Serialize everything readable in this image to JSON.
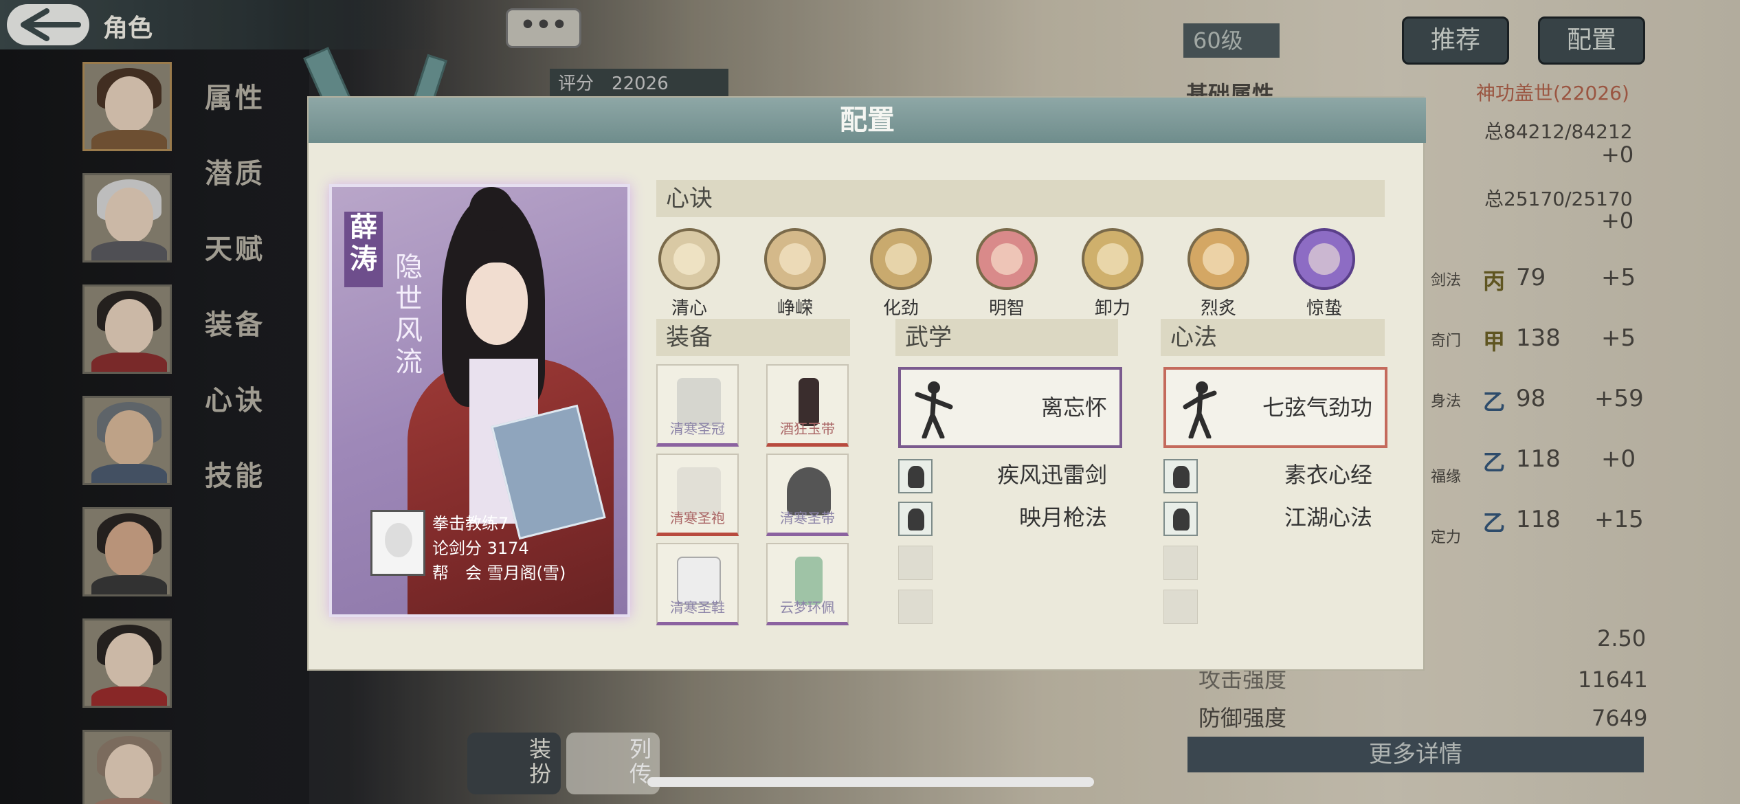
{
  "window": {
    "title": "角色"
  },
  "sidebar": {
    "tabs": [
      "属性",
      "潜质",
      "天赋",
      "装备",
      "心诀",
      "技能"
    ]
  },
  "background": {
    "level": "60级",
    "score_label": "评分",
    "score_value": "22026",
    "buttons": {
      "recommend": "推荐",
      "config": "配置"
    },
    "section_title": "基础属性",
    "power_title": "神功盖世(22026)",
    "hp_total": "总84212/84212",
    "hp_bonus": "+0",
    "mp_total": "总25170/25170",
    "mp_bonus": "+0",
    "stats": [
      {
        "name": "剑法",
        "rank": "丙",
        "value": "79",
        "bonus": "+5"
      },
      {
        "name": "奇门",
        "rank": "甲",
        "value": "138",
        "bonus": "+5"
      },
      {
        "name": "身法",
        "rank": "乙",
        "value": "98",
        "bonus": "+59"
      },
      {
        "name": "福缘",
        "rank": "乙",
        "value": "118",
        "bonus": "+0"
      },
      {
        "name": "定力",
        "rank": "乙",
        "value": "118",
        "bonus": "+15"
      }
    ],
    "extra_value": "2.50",
    "attack_label": "攻击强度",
    "attack_value": "11641",
    "defense_label": "防御强度",
    "defense_value": "7649",
    "more_details": "更多详情",
    "bottom_tabs": {
      "dress": "装扮",
      "bio": "列传"
    },
    "chat": "•••"
  },
  "dialog": {
    "title": "配置",
    "character": {
      "name": "薛涛",
      "epithet": "隐世风流",
      "club_lines": [
        {
          "label": "拳击教练7",
          "value": ""
        },
        {
          "label": "论剑分",
          "value": "3174"
        },
        {
          "label": "帮　会",
          "value": "雪月阁(雪)"
        }
      ]
    },
    "xinjue": {
      "header": "心诀",
      "items": [
        {
          "name": "清心",
          "color": "#d9c9a4"
        },
        {
          "name": "峥嵘",
          "color": "#d4b98a"
        },
        {
          "name": "化劲",
          "color": "#c9aa6e"
        },
        {
          "name": "明智",
          "color": "#d98a8a"
        },
        {
          "name": "卸力",
          "color": "#cfb06c"
        },
        {
          "name": "烈炙",
          "color": "#d4a764"
        },
        {
          "name": "惊蛰",
          "color": "#8d6cc4"
        }
      ]
    },
    "equipment": {
      "header": "装备",
      "items": [
        {
          "name": "清寒圣冠",
          "quality": "purple"
        },
        {
          "name": "酒狂玉带",
          "quality": "red"
        },
        {
          "name": "清寒圣袍",
          "quality": "red"
        },
        {
          "name": "清寒圣带",
          "quality": "purple"
        },
        {
          "name": "清寒圣鞋",
          "quality": "purple"
        },
        {
          "name": "云梦环佩",
          "quality": "purple"
        }
      ]
    },
    "martial": {
      "header": "武学",
      "main": "离忘怀",
      "subs": [
        "疾风迅雷剑",
        "映月枪法"
      ]
    },
    "mental": {
      "header": "心法",
      "main": "七弦气劲功",
      "subs": [
        "素衣心经",
        "江湖心法"
      ]
    }
  },
  "colors": {
    "purple_quality": "#8b62a0",
    "red_quality": "#b84a3e",
    "dialog_header": "#7b9796",
    "dialog_bg": "#ebe9db"
  }
}
